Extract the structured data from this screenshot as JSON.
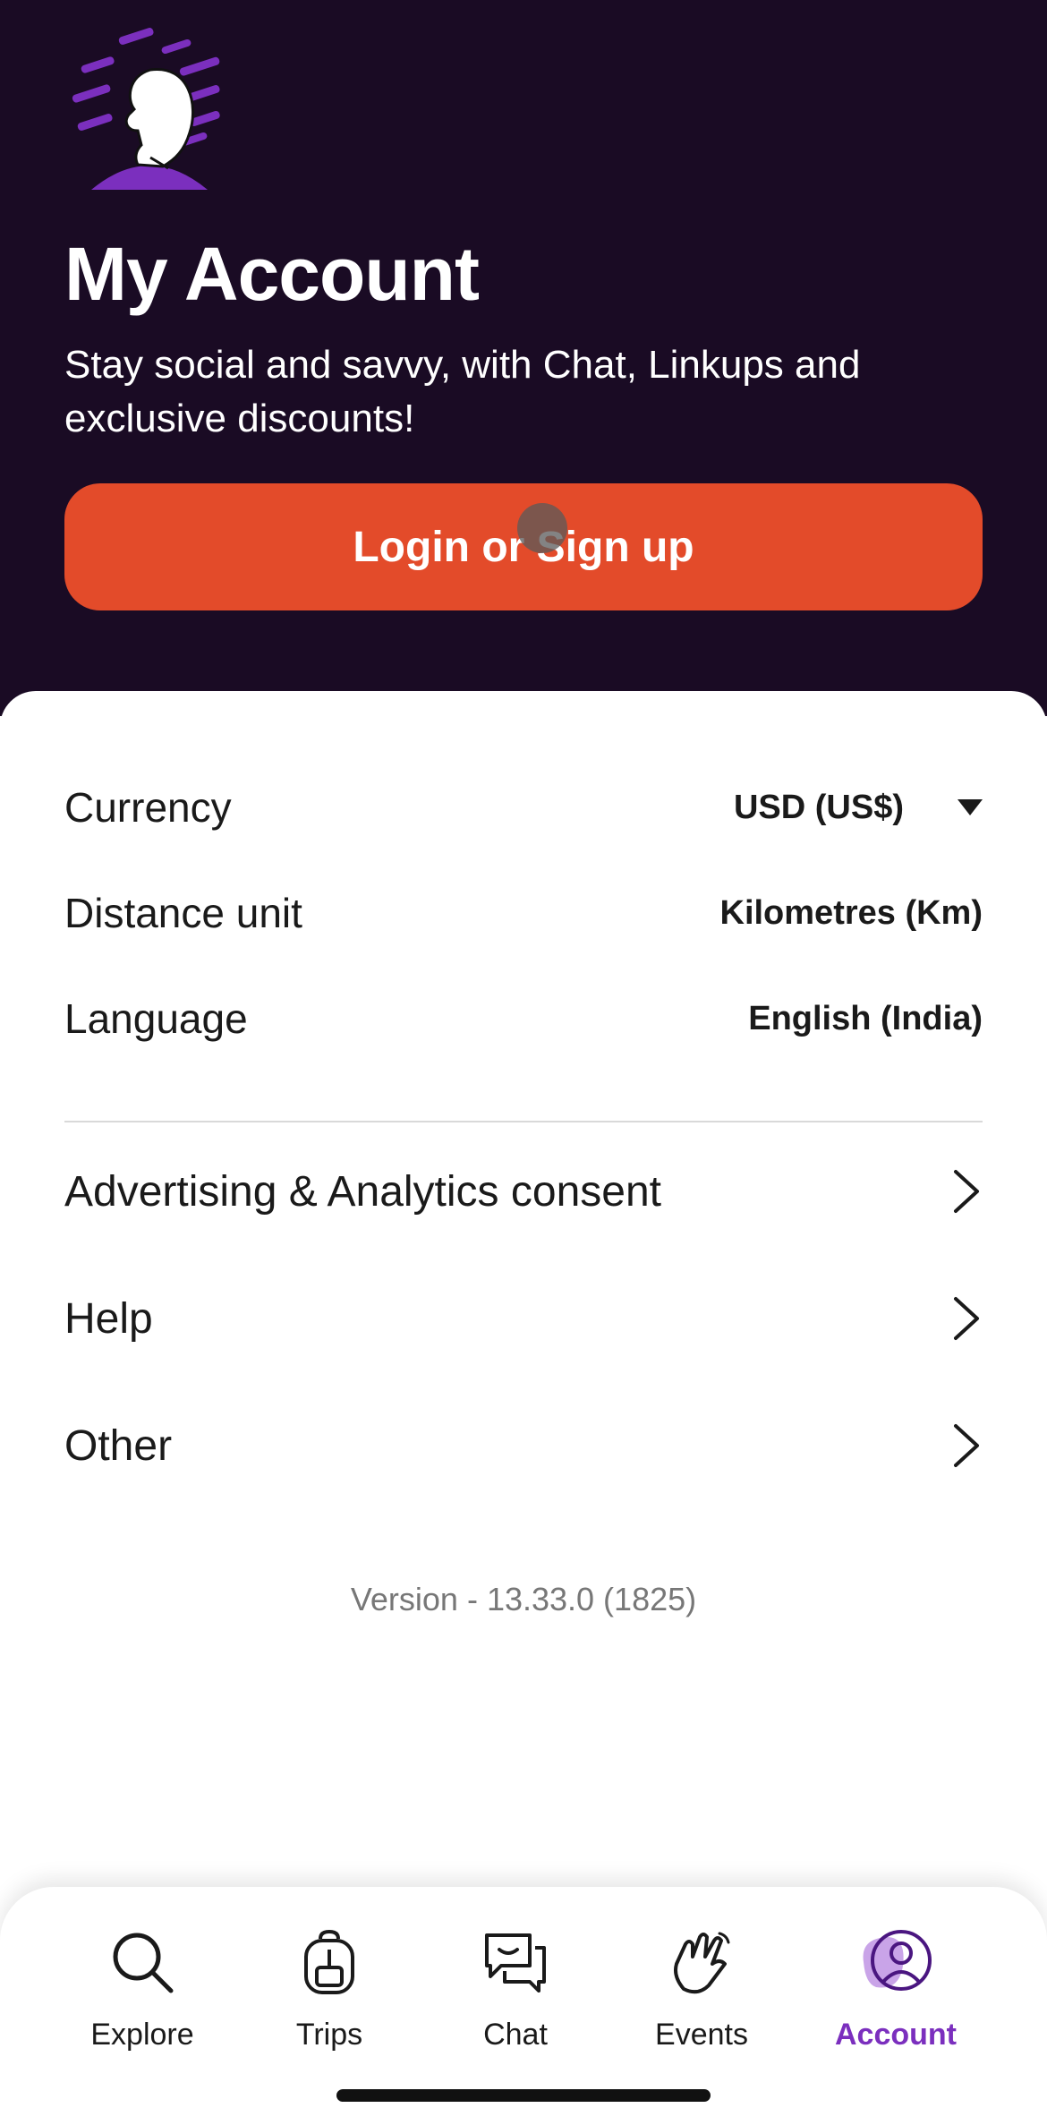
{
  "header": {
    "title": "My Account",
    "subtitle": "Stay social and savvy, with Chat, Linkups and exclusive discounts!",
    "login_button": "Login or Sign up",
    "illustration": "profile-avatar-illustration"
  },
  "settings": {
    "currency": {
      "label": "Currency",
      "value": "USD (US$)",
      "icon": "caret-down-icon"
    },
    "distance": {
      "label": "Distance unit",
      "value": "Kilometres (Km)"
    },
    "language": {
      "label": "Language",
      "value": "English (India)"
    }
  },
  "links": [
    {
      "label": "Advertising & Analytics consent",
      "icon": "chevron-right-icon"
    },
    {
      "label": "Help",
      "icon": "chevron-right-icon"
    },
    {
      "label": "Other",
      "icon": "chevron-right-icon"
    }
  ],
  "version": "Version - 13.33.0 (1825)",
  "tabbar": {
    "tabs": [
      {
        "label": "Explore",
        "icon": "search-icon"
      },
      {
        "label": "Trips",
        "icon": "backpack-icon"
      },
      {
        "label": "Chat",
        "icon": "chat-icon"
      },
      {
        "label": "Events",
        "icon": "waving-hands-icon"
      },
      {
        "label": "Account",
        "icon": "account-icon",
        "active": true
      }
    ]
  },
  "colors": {
    "header_bg": "#1a0b24",
    "accent": "#e34b2a",
    "active_tab": "#7b2fbe"
  }
}
